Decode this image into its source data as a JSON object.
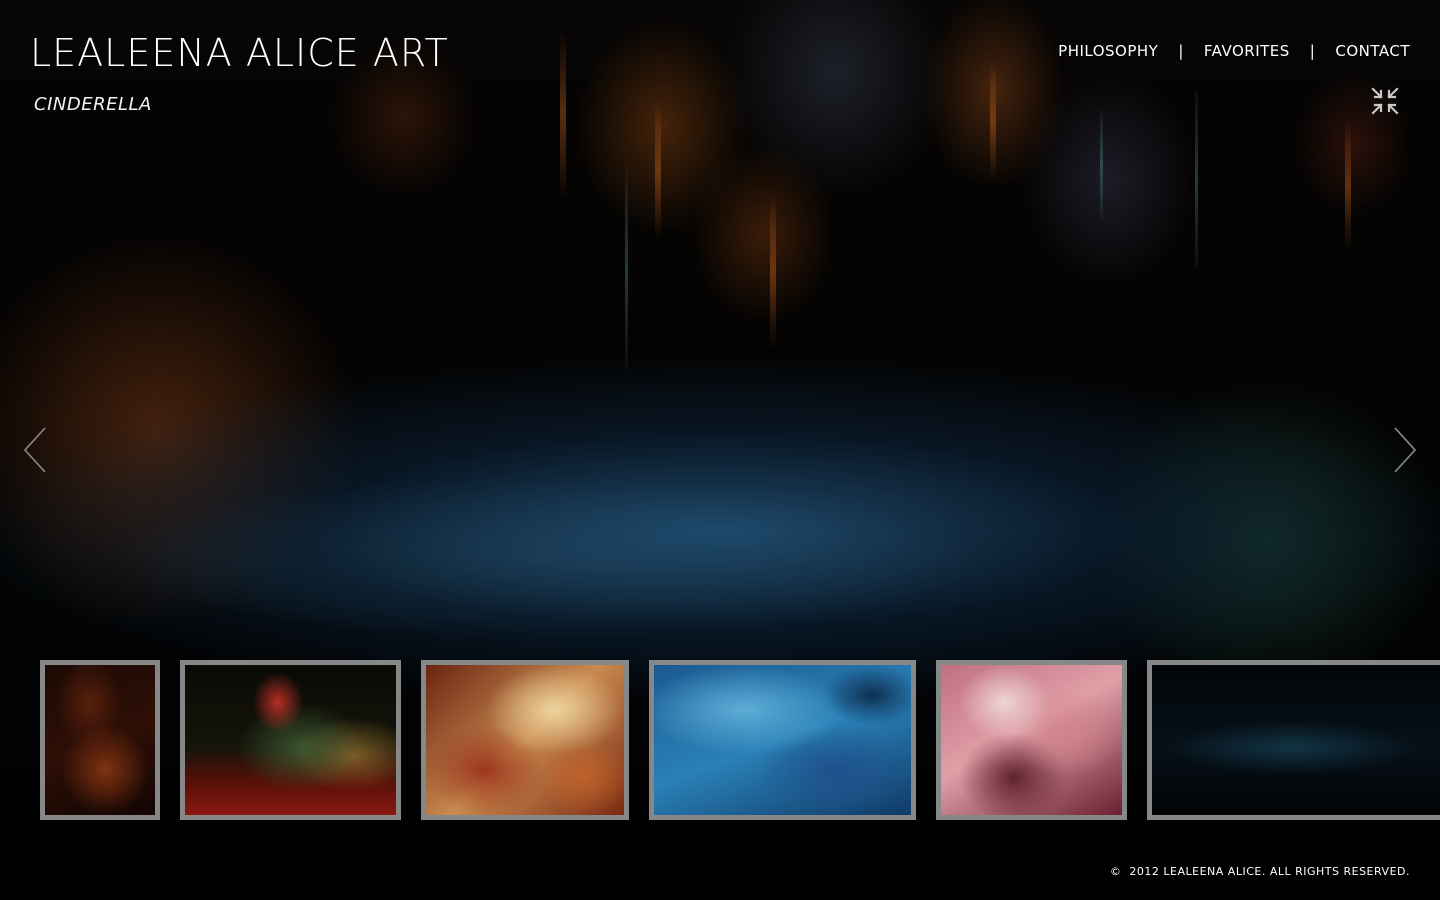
{
  "header": {
    "site_title": "LEALEENA ALICE ART",
    "painting_title": "CINDERELLA"
  },
  "nav": {
    "items": [
      {
        "label": "PHILOSOPHY"
      },
      {
        "label": "FAVORITES"
      },
      {
        "label": "CONTACT"
      }
    ],
    "separator": "|"
  },
  "controls": {
    "fullscreen_icon": "exit-fullscreen-icon",
    "prev_icon": "chevron-left-icon",
    "next_icon": "chevron-right-icon"
  },
  "thumbnails": {
    "count_visible": 6,
    "items": [
      {
        "name": "thumb-1",
        "palette": [
          "#3a1208",
          "#6b2a10",
          "#1a0804"
        ]
      },
      {
        "name": "thumb-2",
        "palette": [
          "#5a1410",
          "#1e3820",
          "#b84020"
        ]
      },
      {
        "name": "thumb-3",
        "palette": [
          "#c89a60",
          "#8a2a14",
          "#e8c890"
        ]
      },
      {
        "name": "thumb-4",
        "palette": [
          "#1e6aa0",
          "#3a8ac0",
          "#0c2a4a"
        ]
      },
      {
        "name": "thumb-5",
        "palette": [
          "#c07888",
          "#5a1a28",
          "#e8d0d0"
        ]
      },
      {
        "name": "thumb-6",
        "palette": [
          "#05111a",
          "#0b2a3a",
          "#040404"
        ]
      }
    ],
    "border_color": "#969696"
  },
  "footer": {
    "copyright_symbol": "©",
    "text": "2012 LEALEENA ALICE. ALL RIGHTS RESERVED."
  }
}
